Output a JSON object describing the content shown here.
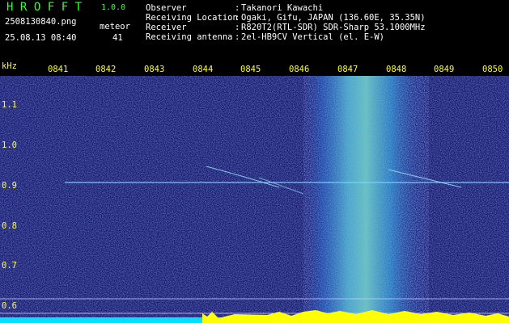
{
  "header": {
    "logo_title": "HROFFT",
    "logo_version": "1.0.0",
    "file_name": "2508130840.png",
    "timestamp": "25.08.13 08:40",
    "meteor_label": "meteor",
    "meteor_count": "41"
  },
  "info": [
    {
      "label": "Observer",
      "value": "Takanori Kawachi"
    },
    {
      "label": "Receiving Location",
      "value": "Ogaki, Gifu, JAPAN (136.60E, 35.35N)"
    },
    {
      "label": "Receiver",
      "value": "R820T2(RTL-SDR) SDR-Sharp 53.1000MHz"
    },
    {
      "label": "Receiving antenna",
      "value": "2el-HB9CV Vertical (el. E-W)"
    }
  ],
  "axes": {
    "y_unit": "kHz",
    "y_ticks": [
      "1.1",
      "1.0",
      "0.9",
      "0.8",
      "0.7",
      "0.6"
    ],
    "x_ticks": [
      "0841",
      "0842",
      "0843",
      "0844",
      "0845",
      "0846",
      "0847",
      "0848",
      "0849",
      "0850"
    ]
  },
  "colors": {
    "background": "#000000",
    "plot_background": "#16186a",
    "label_yellow": "#ffff33",
    "title_green": "#33ff33",
    "baseline_cyan": "#00e0ff",
    "burst_yellow": "#ffff00"
  }
}
